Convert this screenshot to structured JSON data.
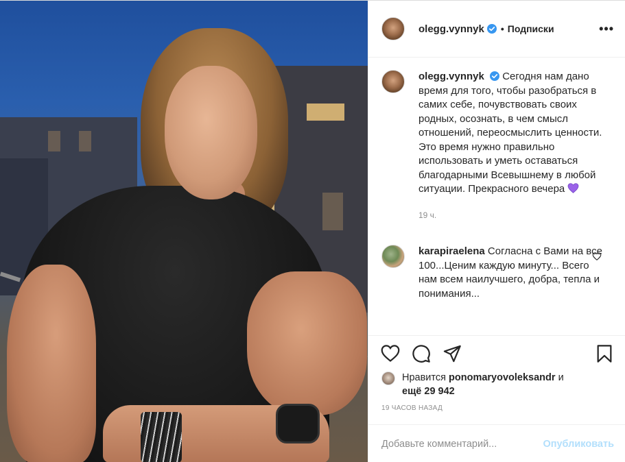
{
  "post": {
    "author": "olegg.vynnyk",
    "follow_status": "Подписки",
    "more_icon": "•••"
  },
  "caption": {
    "username": "olegg.vynnyk",
    "text": "Сегодня нам дано время для того, чтобы разобраться в самих себе, почувствовать своих родных, осознать, в чем смысл отношений, переосмыслить ценности. Это время нужно правильно использовать и уметь оставаться благодарными Всевышнему в любой ситуации. Прекрасного вечера",
    "emoji": "purple-heart-emoji",
    "time": "19 ч."
  },
  "comment": {
    "username": "karapiraelena",
    "text": "Согласна с Вами на все 100...Ценим каждую минуту... Всего нам всем наилучшего, добра, тепла и понимания..."
  },
  "likes": {
    "prefix": "Нравится",
    "user": "ponomaryovoleksandr",
    "mid": "и",
    "count": "ещё 29 942"
  },
  "timestamp": "19 часов назад",
  "add_comment": {
    "placeholder": "Добавьте комментарий...",
    "publish_label": "Опубликовать"
  },
  "colors": {
    "verified": "#3897f0",
    "publish_disabled": "#b2dffc",
    "muted": "#8e8e8e"
  },
  "icons": [
    "heart-icon",
    "comment-icon",
    "share-icon",
    "bookmark-icon",
    "verified-badge-icon",
    "more-options-icon"
  ]
}
